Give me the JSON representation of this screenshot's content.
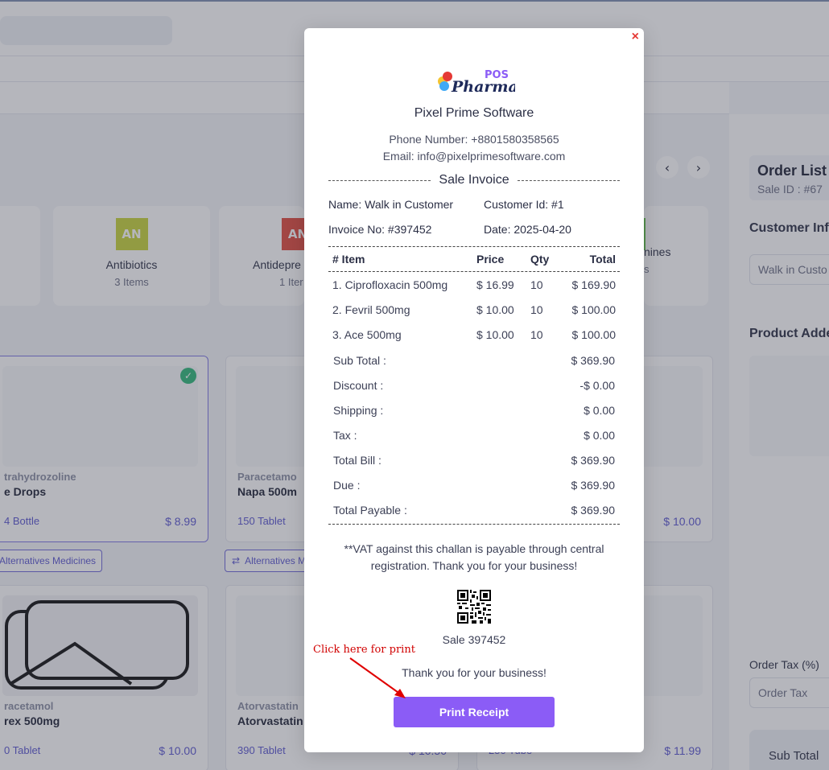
{
  "background": {
    "categories": [
      {
        "badge": "AN",
        "badge_color": "#c7d43a",
        "name": "Antibiotics",
        "count": "3 Items"
      },
      {
        "badge": "AN",
        "badge_color": "#e04b3e",
        "name": "Antidepre",
        "count": "1 Iter"
      },
      {
        "name": "nines",
        "count": "s"
      }
    ],
    "products": [
      {
        "generic": "trahydrozoline",
        "name": "e Drops",
        "stock": "4 Bottle",
        "price": "$ 8.99"
      },
      {
        "generic": "Paracetamo",
        "name": "Napa 500m",
        "stock": "150 Tablet",
        "price": ""
      },
      {
        "generic": "",
        "name": "",
        "stock": "",
        "price": "$ 10.00"
      },
      {
        "generic": "racetamol",
        "name": "rex 500mg",
        "stock": "0 Tablet",
        "price": "$ 10.00"
      },
      {
        "generic": "Atorvastatin",
        "name": "Atorvastatin",
        "stock": "390 Tablet",
        "price": "$ 10.50"
      },
      {
        "generic": "",
        "name": "",
        "stock": "250 Tube",
        "price": "$ 11.99"
      }
    ],
    "alt_button_1": "Alternatives Medicines",
    "alt_button_2": "Alternatives M",
    "right_panel": {
      "title": "Order List",
      "sale_id": "Sale ID : #67",
      "customer_info_label": "Customer Info",
      "customer_value": "Walk in Custo",
      "product_added_label": "Product Added",
      "order_tax_label": "Order Tax (%)",
      "order_tax_placeholder": "Order Tax",
      "sub_total_label": "Sub Total"
    }
  },
  "receipt": {
    "logo_top": "POS",
    "logo_main": "Pharma",
    "company": "Pixel Prime Software",
    "phone": "Phone Number: +8801580358565",
    "email": "Email: info@pixelprimesoftware.com",
    "title": "Sale Invoice",
    "customer_name": "Name: Walk in Customer",
    "customer_id": "Customer Id: #1",
    "invoice_no": "Invoice No: #397452",
    "date": "Date: 2025-04-20",
    "headers": {
      "item": "# Item",
      "price": "Price",
      "qty": "Qty",
      "total": "Total"
    },
    "items": [
      {
        "item": "1. Ciprofloxacin 500mg",
        "price": "$ 16.99",
        "qty": "10",
        "total": "$ 169.90"
      },
      {
        "item": "2. Fevril 500mg",
        "price": "$ 10.00",
        "qty": "10",
        "total": "$ 100.00"
      },
      {
        "item": "3. Ace 500mg",
        "price": "$ 10.00",
        "qty": "10",
        "total": "$ 100.00"
      }
    ],
    "summary": [
      {
        "label": "Sub Total :",
        "value": "$ 369.90"
      },
      {
        "label": "Discount :",
        "value": "-$ 0.00"
      },
      {
        "label": "Shipping :",
        "value": "$ 0.00"
      },
      {
        "label": "Tax :",
        "value": "$ 0.00"
      },
      {
        "label": "Total Bill :",
        "value": "$ 369.90"
      },
      {
        "label": "Due :",
        "value": "$ 369.90"
      },
      {
        "label": "Total Payable :",
        "value": "$ 369.90"
      }
    ],
    "note": "**VAT against this challan is payable through central registration. Thank you for your business!",
    "qr_label": "Sale 397452",
    "thanks": "Thank you for your business!",
    "print_button": "Print Receipt",
    "close": "×"
  },
  "annotation": {
    "text": "Click here for print",
    "color": "#d10000"
  },
  "colors": {
    "accent": "#8b5cf6",
    "link": "#5b57d1"
  }
}
